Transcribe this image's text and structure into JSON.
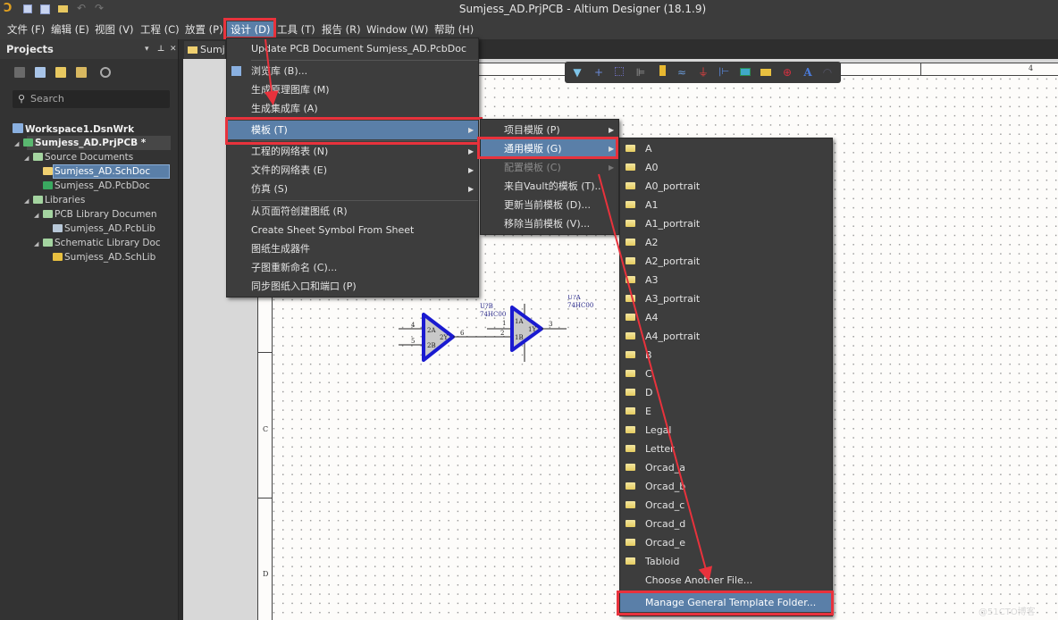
{
  "app": {
    "title": "Sumjess_AD.PrjPCB - Altium Designer (18.1.9)",
    "logo": "Ɔ"
  },
  "menubar": [
    {
      "label": "文件 (F)"
    },
    {
      "label": "编辑 (E)"
    },
    {
      "label": "视图 (V)"
    },
    {
      "label": "工程 (C)"
    },
    {
      "label": "放置 (P)"
    },
    {
      "label": "设计 (D)",
      "active": true
    },
    {
      "label": "工具 (T)"
    },
    {
      "label": "报告 (R)"
    },
    {
      "label": "Window (W)"
    },
    {
      "label": "帮助 (H)"
    }
  ],
  "projects_panel": {
    "title": "Projects",
    "header_buttons": [
      "▾",
      "⊥",
      "✕"
    ],
    "toolbar_icons": [
      "save-icon",
      "copy-icon",
      "folder-search-icon",
      "folder-settings-icon",
      "gear-icon"
    ],
    "search_placeholder": "Search",
    "tree": [
      {
        "label": "Workspace1.DsnWrk",
        "level": 0,
        "icon": "workspace-icon",
        "bold": true
      },
      {
        "label": "Sumjess_AD.PrjPCB *",
        "level": 1,
        "icon": "pcb-project-icon",
        "bold": true,
        "expanded": true,
        "selected_row": true
      },
      {
        "label": "Source Documents",
        "level": 2,
        "icon": "folder-icon",
        "expanded": true
      },
      {
        "label": "Sumjess_AD.SchDoc",
        "level": 3,
        "icon": "schdoc-icon",
        "selected": true
      },
      {
        "label": "Sumjess_AD.PcbDoc",
        "level": 3,
        "icon": "pcbdoc-icon"
      },
      {
        "label": "Libraries",
        "level": 2,
        "icon": "folder-icon",
        "expanded": true
      },
      {
        "label": "PCB Library Documen",
        "level": 3,
        "icon": "folder-icon",
        "expanded": true
      },
      {
        "label": "Sumjess_AD.PcbLib",
        "level": 4,
        "icon": "pcblib-icon"
      },
      {
        "label": "Schematic Library Doc",
        "level": 3,
        "icon": "folder-icon",
        "expanded": true
      },
      {
        "label": "Sumjess_AD.SchLib",
        "level": 4,
        "icon": "schlib-icon"
      }
    ]
  },
  "doc_tab": {
    "label": "Sumje"
  },
  "sheet": {
    "zones_left": [
      "C",
      "D"
    ],
    "zones_top": [
      "4"
    ],
    "components": [
      {
        "designator": "U?B",
        "part": "74HC00",
        "pins_in": [
          "2A",
          "2B"
        ],
        "pin_out": "2Y",
        "pin_numbers": [
          "4",
          "5",
          "6"
        ]
      },
      {
        "designator": "U?A",
        "part": "74HC00",
        "pins_in": [
          "1A",
          "1B"
        ],
        "pin_out": "1Y",
        "pin_numbers": [
          "1",
          "2",
          "3"
        ]
      }
    ]
  },
  "active_bar_icons": [
    "filter-icon",
    "cross-icon",
    "select-rect-icon",
    "align-icon",
    "part-icon",
    "wire-icon",
    "ground-power-icon",
    "bus-entry-icon",
    "sheet-symbol-icon",
    "port-icon",
    "no-erc-icon",
    "text-icon",
    "arc-icon"
  ],
  "design_menu": {
    "items": [
      {
        "label": "Update PCB Document Sumjess_AD.PcbDoc"
      },
      {
        "separator": true
      },
      {
        "label": "浏览库 (B)...",
        "icon": "browse-library-icon"
      },
      {
        "label": "生成原理图库 (M)"
      },
      {
        "label": "生成集成库 (A)"
      },
      {
        "separator": true
      },
      {
        "label": "模板 (T)",
        "submenu": true,
        "highlighted": true
      },
      {
        "separator": true
      },
      {
        "label": "工程的网络表 (N)",
        "submenu": true
      },
      {
        "label": "文件的网络表 (E)",
        "submenu": true
      },
      {
        "label": "仿真 (S)",
        "submenu": true
      },
      {
        "separator": true
      },
      {
        "label": "从页面符创建图纸 (R)"
      },
      {
        "label": "Create Sheet Symbol From Sheet"
      },
      {
        "label": "图纸生成器件"
      },
      {
        "label": "子图重新命名 (C)..."
      },
      {
        "label": "同步图纸入口和端口 (P)"
      }
    ]
  },
  "template_menu": {
    "items": [
      {
        "label": "项目模版 (P)",
        "submenu": true
      },
      {
        "label": "通用模版 (G)",
        "submenu": true,
        "highlighted": true
      },
      {
        "label": "配置模板 (C)",
        "submenu": true,
        "disabled": true
      },
      {
        "label": "来自Vault的模板 (T)..."
      },
      {
        "label": "更新当前模板 (D)..."
      },
      {
        "label": "移除当前模板 (V)..."
      }
    ]
  },
  "general_template_menu": {
    "items": [
      "A",
      "A0",
      "A0_portrait",
      "A1",
      "A1_portrait",
      "A2",
      "A2_portrait",
      "A3",
      "A3_portrait",
      "A4",
      "A4_portrait",
      "B",
      "C",
      "D",
      "E",
      "Legal",
      "Letter",
      "Orcad_a",
      "Orcad_b",
      "Orcad_c",
      "Orcad_d",
      "Orcad_e",
      "Tabloid"
    ],
    "choose_another": "Choose Another File...",
    "manage": "Manage General Template Folder..."
  },
  "watermark": "@51CTO博客",
  "colors": {
    "highlight": "#5a7fa8",
    "annotation_red": "#e8323c",
    "gate_blue": "#1a1ad0"
  }
}
